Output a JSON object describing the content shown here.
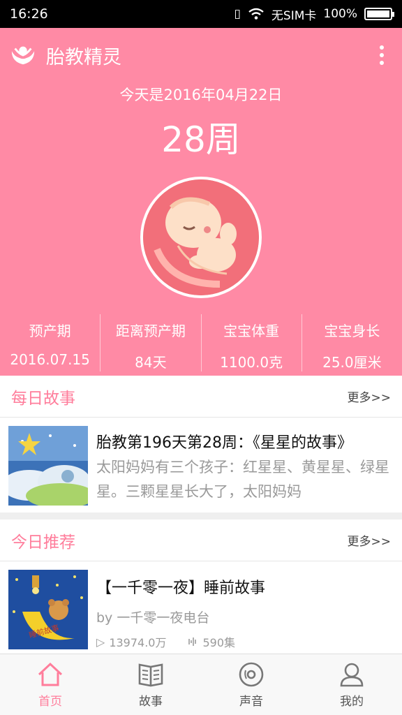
{
  "status": {
    "time": "16:26",
    "sim": "无SIM卡",
    "battery": "100%"
  },
  "header": {
    "title": "胎教精灵",
    "today": "今天是2016年04月22日",
    "week": "28周"
  },
  "stats": [
    {
      "label": "预产期",
      "value": "2016.07.15"
    },
    {
      "label": "距离预产期",
      "value": "84天"
    },
    {
      "label": "宝宝体重",
      "value": "1100.0克"
    },
    {
      "label": "宝宝身长",
      "value": "25.0厘米"
    }
  ],
  "daily_story": {
    "title": "每日故事",
    "more": "更多>>",
    "item": {
      "title": "胎教第196天第28周：《星星的故事》",
      "desc": "太阳妈妈有三个孩子：红星星、黄星星、绿星星。三颗星星长大了，太阳妈妈"
    }
  },
  "recommend": {
    "title": "今日推荐",
    "more": "更多>>",
    "item": {
      "title": "【一千零一夜】睡前故事",
      "by": "by 一千零一夜电台",
      "plays": "13974.0万",
      "episodes": "590集",
      "cover_text": "睡前故事"
    }
  },
  "nav": [
    {
      "label": "首页",
      "icon": "home-icon",
      "active": true
    },
    {
      "label": "故事",
      "icon": "book-icon",
      "active": false
    },
    {
      "label": "声音",
      "icon": "disc-icon",
      "active": false
    },
    {
      "label": "我的",
      "icon": "person-icon",
      "active": false
    }
  ],
  "colors": {
    "brand": "#ff8aa5",
    "accent": "#ff7d9b"
  }
}
